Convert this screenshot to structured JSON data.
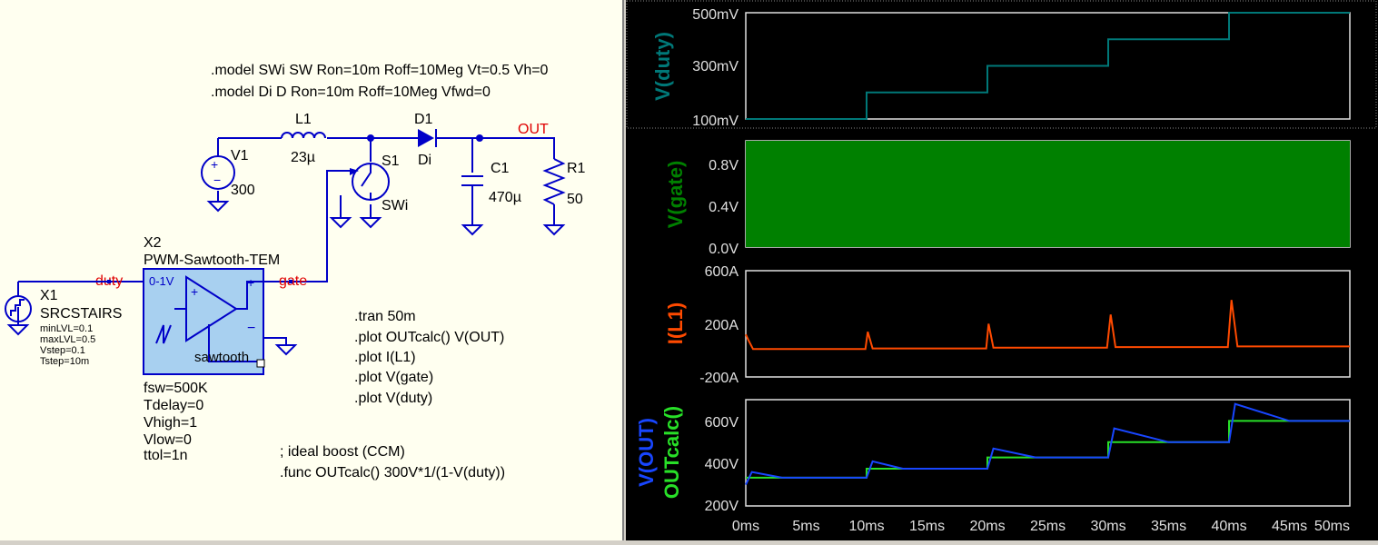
{
  "schematic": {
    "directives": {
      "model_sw": ".model SWi SW Ron=10m Roff=10Meg Vt=0.5 Vh=0",
      "model_d": ".model Di D Ron=10m Roff=10Meg Vfwd=0",
      "tran": ".tran 50m",
      "plot1": ".plot OUTcalc() V(OUT)",
      "plot2": ".plot I(L1)",
      "plot3": ".plot V(gate)",
      "plot4": ".plot V(duty)",
      "comment": "; ideal boost (CCM)",
      "func": ".func OUTcalc() 300V*1/(1-V(duty))"
    },
    "components": {
      "v1_name": "V1",
      "v1_value": "300",
      "l1_name": "L1",
      "l1_value": "23µ",
      "d1_name": "D1",
      "d1_model": "Di",
      "s1_name": "S1",
      "s1_model": "SWi",
      "c1_name": "C1",
      "c1_value": "470µ",
      "r1_name": "R1",
      "r1_value": "50",
      "x1_name": "X1",
      "x1_type": "SRCSTAIRS",
      "x1_p1": "minLVL=0.1",
      "x1_p2": "maxLVL=0.5",
      "x1_p3": "Vstep=0.1",
      "x1_p4": "Tstep=10m",
      "x2_name": "X2",
      "x2_type": "PWM-Sawtooth-TEM",
      "x2_range": "0-1V",
      "x2_saw": "sawtooth",
      "x2_p1": "fsw=500K",
      "x2_p2": "Tdelay=0",
      "x2_p3": "Vhigh=1",
      "x2_p4": "Vlow=0",
      "x2_p5": "ttol=1n"
    },
    "nets": {
      "out": "OUT",
      "duty": "duty",
      "gate": "gate"
    }
  },
  "waveforms": {
    "colors": {
      "duty": "#007878",
      "gate": "#008000",
      "il1": "#ff4a00",
      "out": "#1846ff",
      "calc": "#28e028"
    },
    "panes": {
      "duty": {
        "label": "V(duty)",
        "ticks": [
          "500mV",
          "300mV",
          "100mV"
        ]
      },
      "gate": {
        "label": "V(gate)",
        "ticks": [
          "0.8V",
          "0.4V",
          "0.0V"
        ]
      },
      "il1": {
        "label": "I(L1)",
        "ticks": [
          "600A",
          "200A",
          "-200A"
        ]
      },
      "out": {
        "label_out": "V(OUT)",
        "label_calc": "OUTcalc()",
        "ticks": [
          "600V",
          "400V",
          "200V"
        ]
      }
    },
    "x_ticks": [
      "0ms",
      "5ms",
      "10ms",
      "15ms",
      "20ms",
      "25ms",
      "30ms",
      "35ms",
      "40ms",
      "45ms",
      "50ms"
    ]
  },
  "chart_data": [
    {
      "type": "line",
      "title": "",
      "ylabel": "V(duty)",
      "xlim": [
        0,
        50
      ],
      "ylim": [
        0.1,
        0.5
      ],
      "series": [
        {
          "name": "V(duty)",
          "x": [
            0,
            10,
            10,
            20,
            20,
            30,
            30,
            40,
            40,
            50
          ],
          "values": [
            0.1,
            0.1,
            0.2,
            0.2,
            0.3,
            0.3,
            0.4,
            0.4,
            0.5,
            0.5
          ]
        }
      ]
    },
    {
      "type": "area",
      "title": "",
      "ylabel": "V(gate)",
      "xlim": [
        0,
        50
      ],
      "ylim": [
        0,
        1
      ],
      "series": [
        {
          "name": "V(gate)",
          "x": [
            0,
            50
          ],
          "values": [
            1,
            1
          ]
        }
      ]
    },
    {
      "type": "line",
      "title": "",
      "ylabel": "I(L1)",
      "xlim": [
        0,
        50
      ],
      "ylim": [
        -200,
        600
      ],
      "series": [
        {
          "name": "I(L1)",
          "x": [
            0,
            0.2,
            0.6,
            9.9,
            10.1,
            10.5,
            19.9,
            20.1,
            20.5,
            29.9,
            30.2,
            30.6,
            39.9,
            40.2,
            40.7,
            45,
            50
          ],
          "values": [
            120,
            80,
            10,
            10,
            140,
            15,
            15,
            200,
            20,
            20,
            270,
            25,
            25,
            380,
            30,
            30,
            30
          ]
        }
      ]
    },
    {
      "type": "line",
      "title": "",
      "ylabel": "V(OUT) / OUTcalc()",
      "xlim": [
        0,
        50
      ],
      "ylim": [
        200,
        700
      ],
      "series": [
        {
          "name": "V(OUT)",
          "x": [
            0,
            0.5,
            3,
            10,
            10.5,
            13,
            20,
            20.5,
            24,
            30,
            30.5,
            35,
            40,
            40.5,
            45,
            50
          ],
          "values": [
            300,
            360,
            333,
            333,
            410,
            375,
            375,
            470,
            428,
            428,
            565,
            500,
            500,
            680,
            600,
            600
          ]
        },
        {
          "name": "OUTcalc()",
          "x": [
            0,
            10,
            10,
            20,
            20,
            30,
            30,
            40,
            40,
            50
          ],
          "values": [
            333,
            333,
            375,
            375,
            428,
            428,
            500,
            500,
            600,
            600
          ]
        }
      ]
    }
  ]
}
